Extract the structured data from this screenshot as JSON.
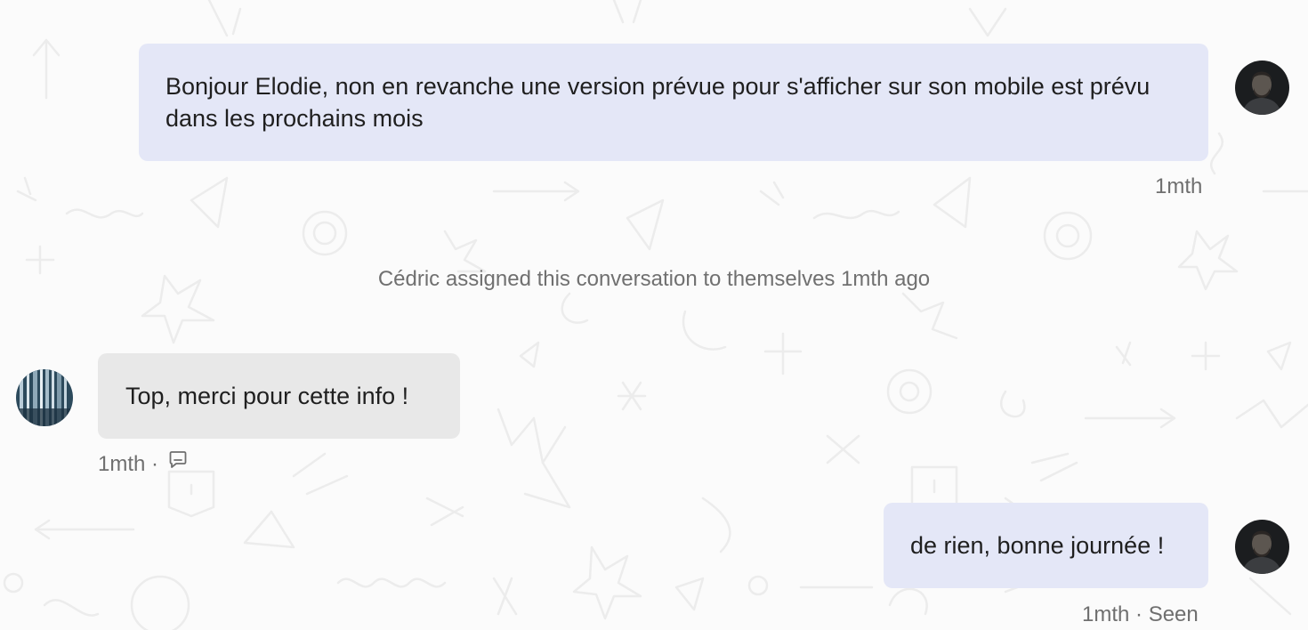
{
  "messages": [
    {
      "id": "msg-1",
      "direction": "outgoing",
      "text": "Bonjour Elodie, non en revanche une version prévue pour s'afficher sur son mobile est prévu dans les prochains mois",
      "time": "1mth",
      "status": ""
    },
    {
      "id": "msg-2",
      "direction": "incoming",
      "text": "Top, merci pour cette info !",
      "time": "1mth",
      "separator": "·",
      "icon": "note-icon"
    },
    {
      "id": "msg-3",
      "direction": "outgoing",
      "text": "de rien, bonne journée !",
      "time": "1mth",
      "separator": "·",
      "status": "Seen"
    }
  ],
  "events": [
    {
      "text": "Cédric assigned this conversation to themselves 1mth ago"
    }
  ],
  "colors": {
    "outgoing_bubble": "#e4e7f7",
    "incoming_bubble": "#e8e8e8",
    "meta_text": "#6f6f6f",
    "background": "#fbfbfb"
  },
  "icons": {
    "agent_avatar": "agent-avatar",
    "customer_avatar": "customer-avatar",
    "note_icon": "note-icon"
  }
}
